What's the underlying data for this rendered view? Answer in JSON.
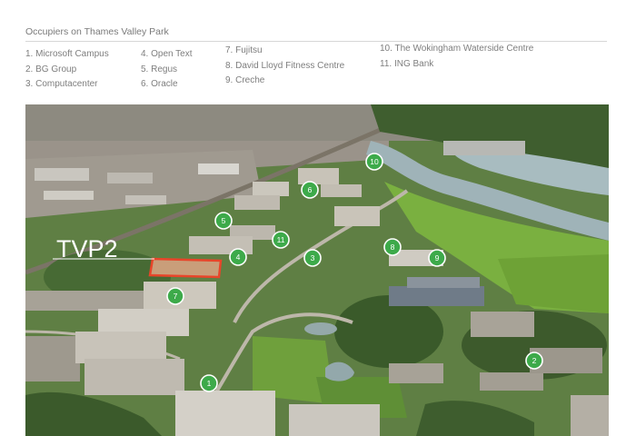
{
  "heading": "Occupiers on Thames Valley Park",
  "occupiers": [
    [
      "1. Microsoft Campus",
      "2. BG Group",
      "3. Computacenter"
    ],
    [
      "4. Open Text",
      "5. Regus",
      "6. Oracle"
    ],
    [
      "7. Fujitsu",
      "8. David Lloyd Fitness Centre",
      "9. Creche"
    ],
    [
      "10. The Wokingham Waterside Centre",
      "11. ING Bank"
    ]
  ],
  "map": {
    "site_label": "TVP2",
    "site_outline_color": "#e8452a",
    "marker_color": "#3daa4a",
    "markers": [
      "1",
      "2",
      "3",
      "4",
      "5",
      "6",
      "7",
      "8",
      "9",
      "10",
      "11"
    ]
  }
}
